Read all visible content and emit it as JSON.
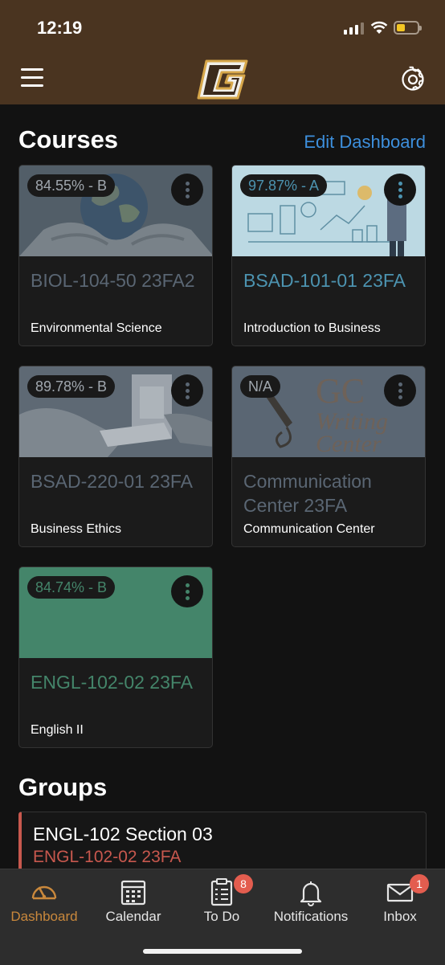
{
  "status_bar": {
    "time": "12:19"
  },
  "header": {
    "logo_letter": "G"
  },
  "courses": {
    "title": "Courses",
    "edit_label": "Edit Dashboard",
    "items": [
      {
        "grade": "84.55% - B",
        "code": "BIOL-104-50 23FA2",
        "name": "Environmental Science",
        "color": "#5a6673"
      },
      {
        "grade": "97.87% - A",
        "code": "BSAD-101-01 23FA",
        "name": "Introduction to Business",
        "color": "#4c93b0"
      },
      {
        "grade": "89.78% - B",
        "code": "BSAD-220-01 23FA",
        "name": "Business Ethics",
        "color": "#5a6673"
      },
      {
        "grade": "N/A",
        "code": "Communication Center 23FA",
        "name": "Communication Center",
        "color": "#5a6673"
      },
      {
        "grade": "84.74% - B",
        "code": "ENGL-102-02 23FA",
        "name": "English II",
        "color": "#44856a"
      }
    ]
  },
  "groups": {
    "title": "Groups",
    "items": [
      {
        "title": "ENGL-102 Section 03",
        "subtitle": "ENGL-102-02 23FA"
      }
    ]
  },
  "tabbar": {
    "items": [
      {
        "label": "Dashboard",
        "icon": "dashboard-gauge-icon",
        "active": true
      },
      {
        "label": "Calendar",
        "icon": "calendar-icon"
      },
      {
        "label": "To Do",
        "icon": "todo-clipboard-icon",
        "badge": "8"
      },
      {
        "label": "Notifications",
        "icon": "bell-icon"
      },
      {
        "label": "Inbox",
        "icon": "envelope-icon",
        "badge": "1"
      }
    ]
  },
  "colors": {
    "header_bg": "#4a3420",
    "accent_link": "#3d8fdc",
    "active_tab": "#c9883c",
    "badge": "#e35d4f"
  }
}
